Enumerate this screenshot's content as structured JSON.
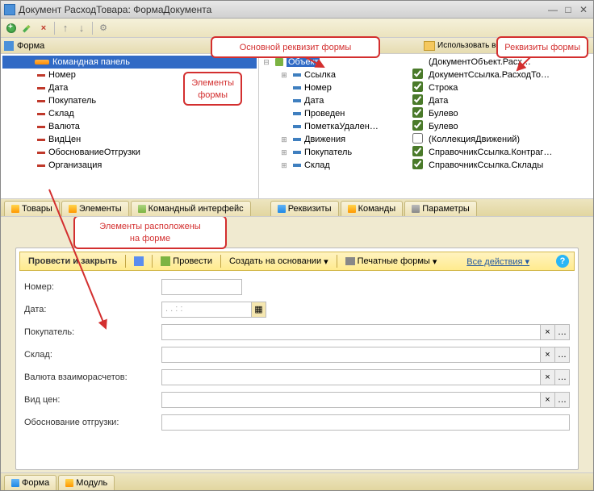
{
  "window": {
    "title": "Документ РасходТовара: ФормаДокумента"
  },
  "form_tree": {
    "header": "Форма",
    "items": [
      {
        "label": "Командная панель",
        "icon": "bar",
        "selected": true
      },
      {
        "label": "Номер",
        "icon": "minus"
      },
      {
        "label": "Дата",
        "icon": "minus"
      },
      {
        "label": "Покупатель",
        "icon": "minus"
      },
      {
        "label": "Склад",
        "icon": "minus"
      },
      {
        "label": "Валюта",
        "icon": "minus"
      },
      {
        "label": "ВидЦен",
        "icon": "minus"
      },
      {
        "label": "ОбоснованиеОтгрузки",
        "icon": "minus"
      },
      {
        "label": "Организация",
        "icon": "minus"
      }
    ]
  },
  "right_panel": {
    "col_use": "Использовать всегда",
    "root": "Объект",
    "root_type": "(ДокументОбъект.Расх…",
    "rows": [
      {
        "label": "Ссылка",
        "checked": true,
        "type": "ДокументСсылка.РасходТо…",
        "expandable": true
      },
      {
        "label": "Номер",
        "checked": true,
        "type": "Строка"
      },
      {
        "label": "Дата",
        "checked": true,
        "type": "Дата"
      },
      {
        "label": "Проведен",
        "checked": true,
        "type": "Булево"
      },
      {
        "label": "ПометкаУдален…",
        "checked": true,
        "type": "Булево"
      },
      {
        "label": "Движения",
        "checked": false,
        "type": "(КоллекцияДвижений)",
        "expandable": true
      },
      {
        "label": "Покупатель",
        "checked": true,
        "type": "СправочникСсылка.Контраг…",
        "expandable": true
      },
      {
        "label": "Склад",
        "checked": true,
        "type": "СправочникСсылка.Склады",
        "expandable": true
      }
    ]
  },
  "tabs_left": [
    "Товары",
    "Элементы",
    "Командный интерфейс"
  ],
  "tabs_right": [
    "Реквизиты",
    "Команды",
    "Параметры"
  ],
  "callouts": {
    "elements": "Элементы\nформы",
    "main_req": "Основной реквизит формы",
    "form_req": "Реквизиты формы",
    "placed": "Элементы расположены\nна форме"
  },
  "preview": {
    "toolbar": {
      "main": "Провести и закрыть",
      "conduct": "Провести",
      "create_base": "Создать на основании",
      "print": "Печатные формы",
      "all_actions": "Все действия"
    },
    "fields": [
      {
        "label": "Номер:",
        "kind": "short"
      },
      {
        "label": "Дата:",
        "kind": "date",
        "value": ". .  : :"
      },
      {
        "label": "Покупатель:",
        "kind": "lookup"
      },
      {
        "label": "Склад:",
        "kind": "lookup"
      },
      {
        "label": "Валюта взаиморасчетов:",
        "kind": "lookup"
      },
      {
        "label": "Вид цен:",
        "kind": "lookup"
      },
      {
        "label": "Обоснование отгрузки:",
        "kind": "text"
      }
    ]
  },
  "bottom_tabs": [
    "Форма",
    "Модуль"
  ]
}
